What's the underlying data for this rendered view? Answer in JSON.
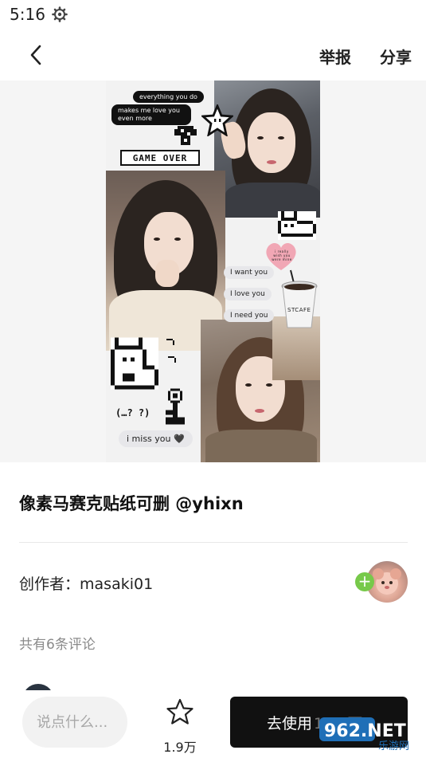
{
  "status_bar": {
    "time": "5:16",
    "settings_icon": "gear-icon"
  },
  "nav": {
    "back_icon": "chevron-left-icon",
    "report_label": "举报",
    "share_label": "分享"
  },
  "collage": {
    "bubbles_top": [
      "everything you do",
      "makes me love you even more"
    ],
    "gameover_text": "GAME OVER",
    "bubbles_mid": [
      "I want you",
      "I love you",
      "I need you"
    ],
    "heart_text": "i really wish you were mine",
    "cup_text": "STCAFE",
    "dots_text": "(…? ?)",
    "bubble_bottom": "i miss you 🖤"
  },
  "post": {
    "title": "像素马赛克贴纸可删 @yhixn"
  },
  "creator": {
    "label": "创作者：",
    "name": "masaki01",
    "follow_icon": "plus-icon"
  },
  "comments": {
    "count_text": "共有6条评论"
  },
  "bottom_bar": {
    "comment_placeholder": "说点什么...",
    "favorite_icon": "star-icon",
    "favorite_count": "1.9万",
    "use_label": "去使用",
    "use_count": "10.7万"
  },
  "watermark": {
    "text": "962.NET",
    "subtext": "乐游网"
  },
  "colors": {
    "use_button_bg": "#111111",
    "follow_green": "#77c94a",
    "comment_bg": "#f2f2f2"
  }
}
